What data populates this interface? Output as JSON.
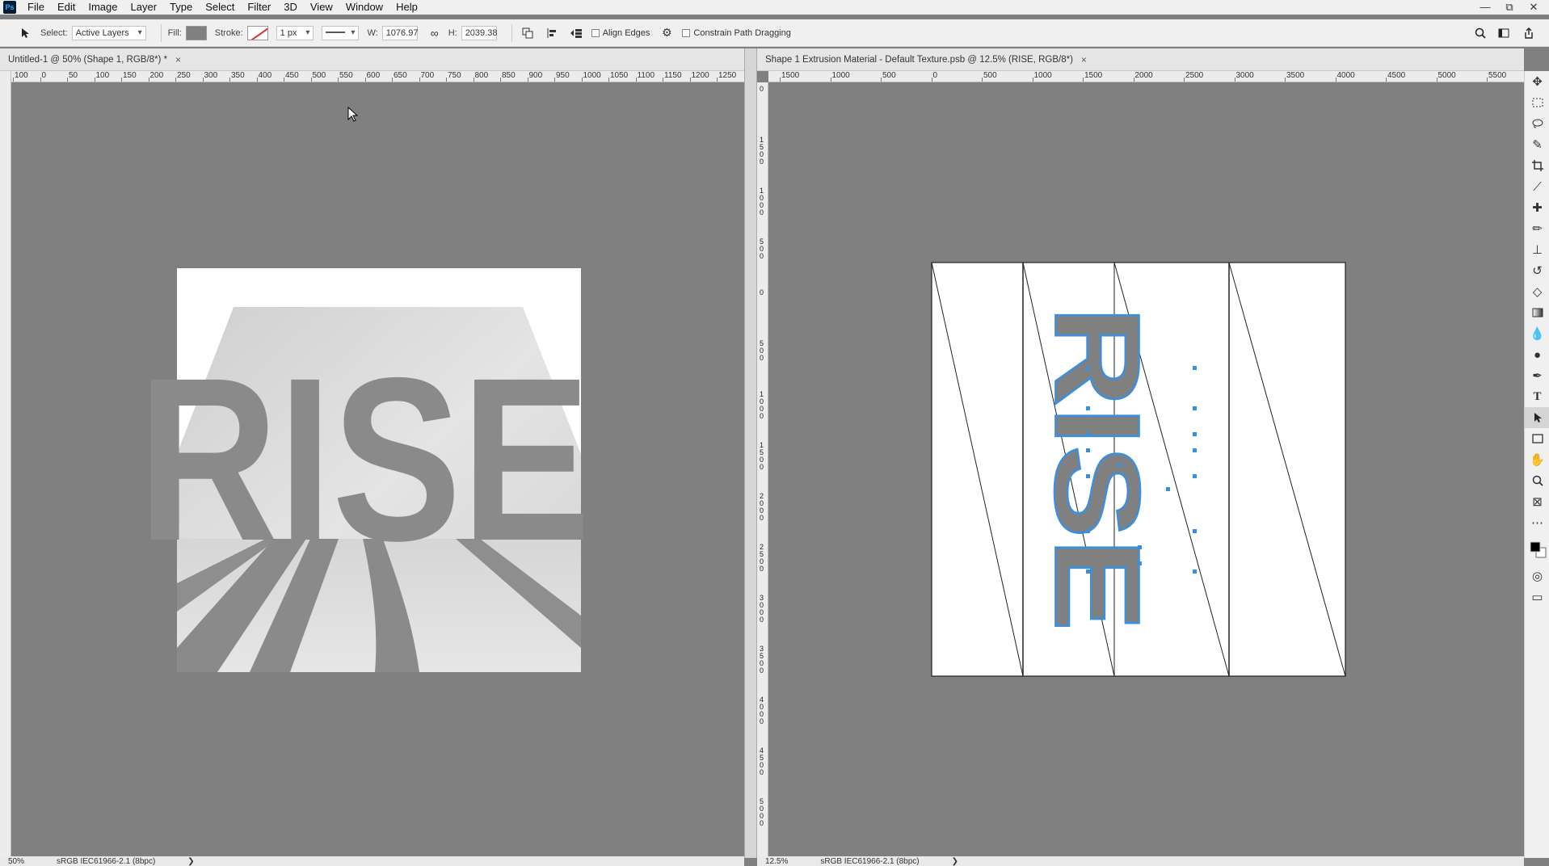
{
  "app": {
    "logo_text": "Ps"
  },
  "menu": [
    "File",
    "Edit",
    "Image",
    "Layer",
    "Type",
    "Select",
    "Filter",
    "3D",
    "View",
    "Window",
    "Help"
  ],
  "window_controls": [
    "—",
    "⧉",
    "✕"
  ],
  "options_bar": {
    "select_label": "Select:",
    "select_value": "Active Layers",
    "fill_label": "Fill:",
    "stroke_label": "Stroke:",
    "stroke_width": "1 px",
    "w_label": "W:",
    "w_value": "1076.97",
    "h_label": "H:",
    "h_value": "2039.38",
    "align_edges_label": "Align Edges",
    "constrain_label": "Constrain Path Dragging"
  },
  "doc_left": {
    "tab_title": "Untitled-1 @ 50% (Shape 1, RGB/8*) *",
    "close_glyph": "×",
    "ruler_labels": [
      "100",
      "0",
      "50",
      "100",
      "150",
      "200",
      "250",
      "300",
      "350",
      "400",
      "450",
      "500",
      "550",
      "600",
      "650",
      "700",
      "750",
      "800",
      "850",
      "900",
      "950",
      "1000",
      "1050",
      "1100",
      "1150",
      "1200",
      "1250"
    ],
    "artwork_text": "RISE",
    "zoom": "50%",
    "color_profile": "sRGB IEC61966-2.1 (8bpc)"
  },
  "doc_right": {
    "tab_title": "Shape 1 Extrusion Material - Default Texture.psb @ 12.5% (RISE, RGB/8*)",
    "close_glyph": "×",
    "ruler_labels": [
      "1500",
      "1000",
      "500",
      "0",
      "500",
      "1000",
      "1500",
      "2000",
      "2500",
      "3000",
      "3500",
      "4000",
      "4500",
      "5000",
      "5500"
    ],
    "vertical_ruler_labels": [
      "0",
      "1500",
      "1000",
      "500",
      "0",
      "500",
      "1000",
      "1500",
      "2000",
      "2500",
      "3000",
      "3500",
      "4000",
      "4500",
      "5000"
    ],
    "texture_text": "RISE",
    "zoom": "12.5%",
    "color_profile": "sRGB IEC61966-2.1 (8bpc)"
  },
  "toolbox": [
    "move-tool",
    "marquee-tool",
    "lasso-tool",
    "quick-select-tool",
    "crop-tool",
    "eyedropper-tool",
    "healing-tool",
    "brush-tool",
    "stamp-tool",
    "history-brush-tool",
    "eraser-tool",
    "gradient-tool",
    "blur-tool",
    "dodge-tool",
    "pen-tool",
    "type-tool",
    "path-select-tool",
    "rectangle-tool",
    "hand-tool",
    "zoom-tool",
    "frame-tool",
    "more-tool"
  ],
  "colors": {
    "canvas_gray": "#808080",
    "selection_blue": "#3d8fdc"
  }
}
